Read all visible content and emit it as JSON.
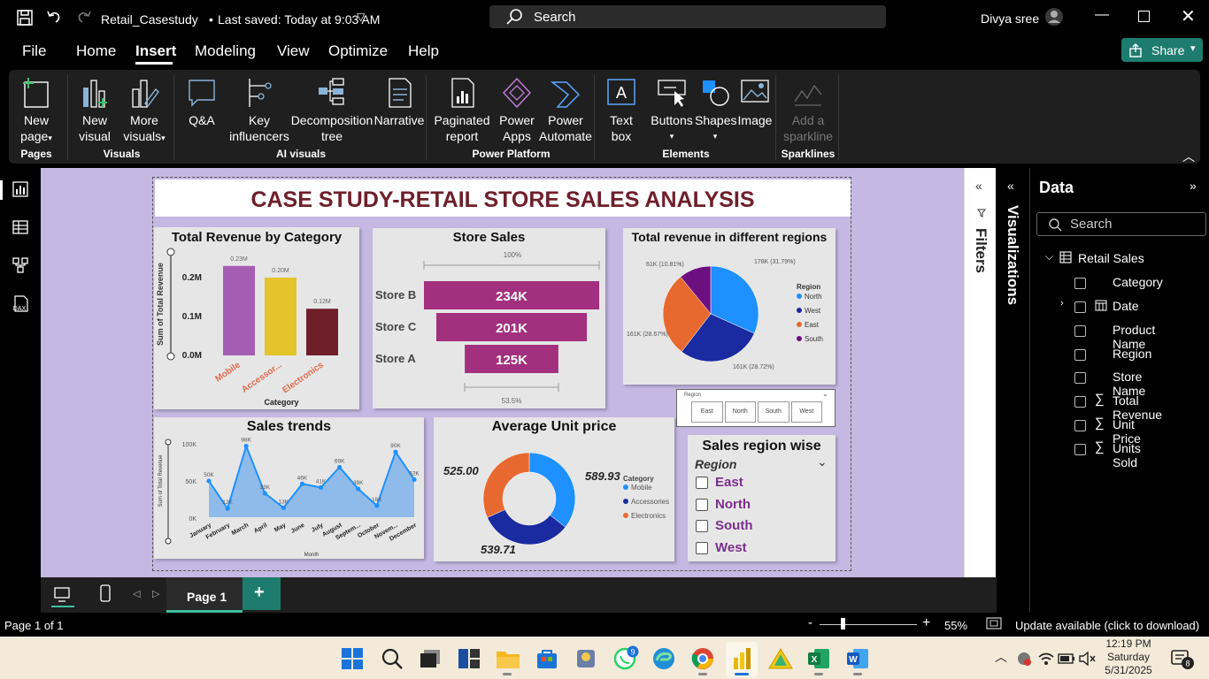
{
  "titlebar": {
    "file_name": "Retail_Casestudy",
    "saved_status": "Last saved: Today at 9:03 AM",
    "search_placeholder": "Search",
    "user_name": "Divya sree"
  },
  "menu": {
    "items": [
      "File",
      "Home",
      "Insert",
      "Modeling",
      "View",
      "Optimize",
      "Help"
    ],
    "active": "Insert",
    "share_label": "Share"
  },
  "ribbon": {
    "pages": {
      "new_page": "New page",
      "group": "Pages"
    },
    "visuals": {
      "new_visual_1": "New",
      "new_visual_2": "visual",
      "more_visuals_1": "More",
      "more_visuals_2": "visuals",
      "group": "Visuals"
    },
    "ai": {
      "qa": "Q&A",
      "key_1": "Key",
      "key_2": "influencers",
      "decomp_1": "Decomposition",
      "decomp_2": "tree",
      "narrative": "Narrative",
      "group": "AI visuals"
    },
    "platform": {
      "paginated_1": "Paginated",
      "paginated_2": "report",
      "apps_1": "Power",
      "apps_2": "Apps",
      "automate_1": "Power",
      "automate_2": "Automate",
      "group": "Power Platform"
    },
    "elements": {
      "textbox_1": "Text",
      "textbox_2": "box",
      "buttons": "Buttons",
      "shapes": "Shapes",
      "image": "Image",
      "group": "Elements"
    },
    "sparklines": {
      "add_1": "Add a",
      "add_2": "sparkline",
      "group": "Sparklines"
    }
  },
  "report": {
    "title": "CASE STUDY-RETAIL STORE SALES ANALYSIS"
  },
  "revenue_by_category": {
    "title": "Total Revenue by Category",
    "ylabel": "Sum of Total Revenue",
    "xlabel": "Category",
    "yticks": [
      "0.2M",
      "0.1M",
      "0.0M"
    ],
    "categories": [
      "Mobile",
      "Accessor...",
      "Electronics"
    ],
    "data_labels": [
      "0.23M",
      "0.20M",
      "0.12M"
    ],
    "values": [
      0.23,
      0.2,
      0.12
    ],
    "colors": [
      "#a55db3",
      "#e4c32b",
      "#6e1f2a"
    ]
  },
  "store_sales": {
    "title": "Store Sales",
    "top_pct": "100%",
    "bottom_pct": "53.5%",
    "stores": [
      "Store B",
      "Store C",
      "Store A"
    ],
    "labels": [
      "234K",
      "201K",
      "125K"
    ],
    "values": [
      234,
      201,
      125
    ],
    "color": "#a3307e"
  },
  "regions_pie": {
    "title": "Total revenue in different regions",
    "legend_title": "Region",
    "legend": [
      "North",
      "West",
      "East",
      "South"
    ],
    "colors": [
      "#1e90ff",
      "#1a2aa0",
      "#e8692f",
      "#6e0f80"
    ],
    "values": [
      178,
      161,
      161,
      61
    ],
    "labels": [
      "178K (31.79%)",
      "161K (28.72%)",
      "161K (28.67%)",
      "61K (10.81%)"
    ]
  },
  "region_slicer_top": {
    "title": "Region",
    "options": [
      "East",
      "North",
      "South",
      "West"
    ]
  },
  "sales_trends": {
    "title": "Sales trends",
    "ylabel": "Sum of Total Revenue",
    "xlabel": "Month",
    "yticks": [
      "100K",
      "50K",
      "0K"
    ],
    "months": [
      "January",
      "February",
      "March",
      "April",
      "May",
      "June",
      "July",
      "August",
      "Septem...",
      "October",
      "Novem...",
      "December"
    ],
    "values": [
      50,
      12,
      98,
      33,
      13,
      46,
      41,
      69,
      39,
      16,
      90,
      52
    ],
    "point_labels": [
      "50K",
      "12K",
      "98K",
      "33K",
      "13K",
      "46K",
      "41K",
      "69K",
      "39K",
      "16K",
      "90K",
      "52K"
    ]
  },
  "avg_unit_price": {
    "title": "Average Unit price",
    "legend_title": "Category",
    "legend": [
      "Mobile",
      "Accessories",
      "Electronics"
    ],
    "colors": [
      "#1e90ff",
      "#1a2aa0",
      "#e8692f"
    ],
    "values": [
      589.93,
      539.71,
      525.0
    ],
    "labels": [
      "589.93",
      "539.71",
      "525.00"
    ]
  },
  "sales_region_wise": {
    "title": "Sales region wise",
    "header": "Region",
    "options": [
      "East",
      "North",
      "South",
      "West"
    ]
  },
  "filters_label": "Filters",
  "visualizations_label": "Visualizations",
  "data_pane": {
    "title": "Data",
    "search_placeholder": "Search",
    "table": "Retail Sales",
    "fields": [
      "Category",
      "Date",
      "Product Name",
      "Region",
      "Store Name",
      "Total Revenue",
      "Unit Price",
      "Units Sold"
    ]
  },
  "page_tabs": {
    "page1": "Page 1",
    "add": "+"
  },
  "status": {
    "page_info": "Page 1 of 1",
    "zoom": "55%",
    "update": "Update available (click to download)"
  },
  "taskbar": {
    "time": "12:19 PM",
    "day": "Saturday",
    "date": "5/31/2025",
    "whatsapp_badge": "9",
    "notif_badge": "8"
  }
}
